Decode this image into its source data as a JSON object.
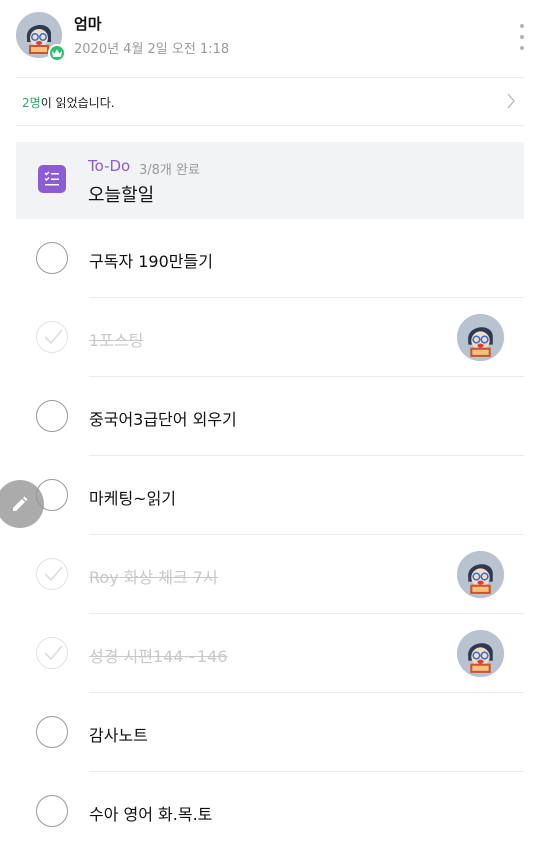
{
  "post": {
    "author": "엄마",
    "time": "2020년 4월 2일 오전 1:18"
  },
  "read_receipt": {
    "count": "2명",
    "suffix": "이 읽었습니다."
  },
  "todo": {
    "label": "To-Do",
    "progress": "3/8개 완료",
    "title": "오늘할일",
    "accent_color": "#8b5cd6"
  },
  "tasks": [
    {
      "text": "구독자 190만들기",
      "done": false,
      "assignee": false
    },
    {
      "text": "1포스팅",
      "done": true,
      "assignee": true
    },
    {
      "text": "중국어3급단어 외우기",
      "done": false,
      "assignee": false
    },
    {
      "text": "마케팅~읽기",
      "done": false,
      "assignee": false
    },
    {
      "text": "Roy 화상 체크 7시",
      "done": true,
      "assignee": true
    },
    {
      "text": "성경 시편144~146",
      "done": true,
      "assignee": true
    },
    {
      "text": "감사노트",
      "done": false,
      "assignee": false
    },
    {
      "text": "수아 영어 화.목.토",
      "done": false,
      "assignee": false
    }
  ],
  "icons": {
    "more": "more-vertical-icon",
    "chevron": "chevron-right-icon",
    "todo": "checklist-icon",
    "badge": "crown-icon",
    "fab": "pencil-icon"
  },
  "colors": {
    "read_count": "#2aa86a",
    "crown_badge": "#2fbf71"
  }
}
